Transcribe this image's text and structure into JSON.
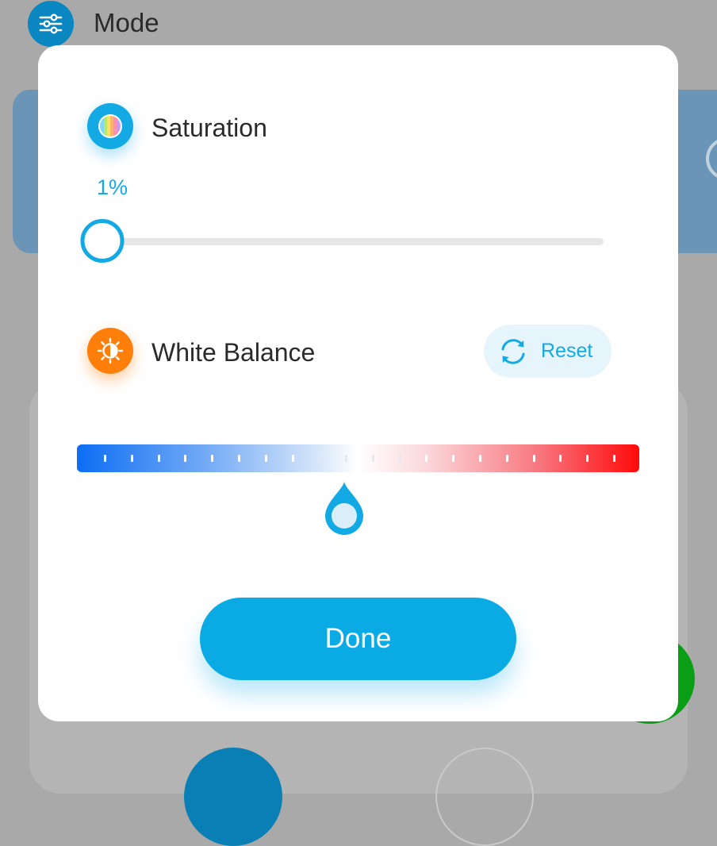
{
  "background": {
    "mode_label": "Mode",
    "mode_icon": "sliders-icon"
  },
  "dialog": {
    "saturation": {
      "title": "Saturation",
      "icon": "color-palette-icon",
      "value_label": "1%",
      "value": 1
    },
    "white_balance": {
      "title": "White Balance",
      "icon": "brightness-contrast-icon",
      "reset_label": "Reset",
      "reset_icon": "refresh-icon",
      "tick_count": 20,
      "position": 0.476
    },
    "done_label": "Done"
  },
  "colors": {
    "accent": "#0aaae5",
    "orange": "#ff7f0a",
    "wb_cold": "#0d6ef4",
    "wb_warm": "#ff0a0a"
  }
}
